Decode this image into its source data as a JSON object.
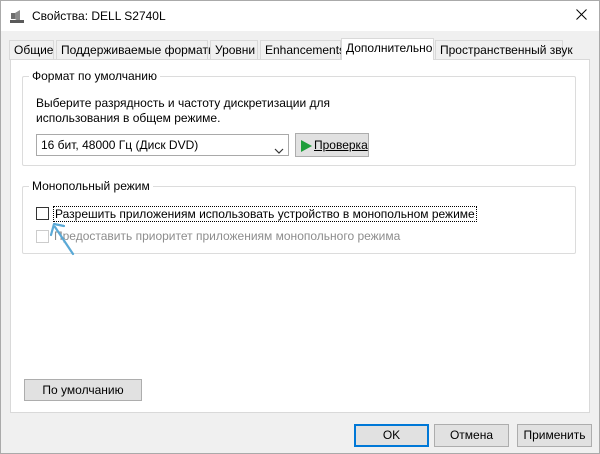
{
  "window": {
    "title": "Свойства: DELL S2740L",
    "close_glyph": "✕"
  },
  "tabs": [
    {
      "label": "Общие",
      "active": false
    },
    {
      "label": "Поддерживаемые форматы",
      "active": false
    },
    {
      "label": "Уровни",
      "active": false
    },
    {
      "label": "Enhancements",
      "active": false
    },
    {
      "label": "Дополнительно",
      "active": true
    },
    {
      "label": "Пространственный звук",
      "active": false
    }
  ],
  "default_format": {
    "group_label": "Формат по умолчанию",
    "description": "Выберите разрядность и частоту дискретизации для использования в общем режиме.",
    "selected_format": "16 бит, 48000 Гц (Диск DVD)",
    "test_button_label": "Проверка"
  },
  "exclusive_mode": {
    "group_label": "Монопольный режим",
    "allow_exclusive_label": "Разрешить приложениям использовать устройство в монопольном режиме",
    "allow_exclusive_checked": false,
    "priority_label": "Предоставить приоритет приложениям монопольного режима",
    "priority_checked": false,
    "priority_enabled": false
  },
  "buttons": {
    "restore_default_label": "По умолчанию",
    "ok_label": "OK",
    "cancel_label": "Отмена",
    "apply_label": "Применить"
  },
  "colors": {
    "accent": "#0078d7",
    "play_icon": "#1f9e3b",
    "annotation_arrow": "#5aa9d6"
  },
  "icons": {
    "title": "speaker-icon",
    "close": "close-icon",
    "test": "play-icon",
    "dropdown": "chevron-down-icon"
  }
}
